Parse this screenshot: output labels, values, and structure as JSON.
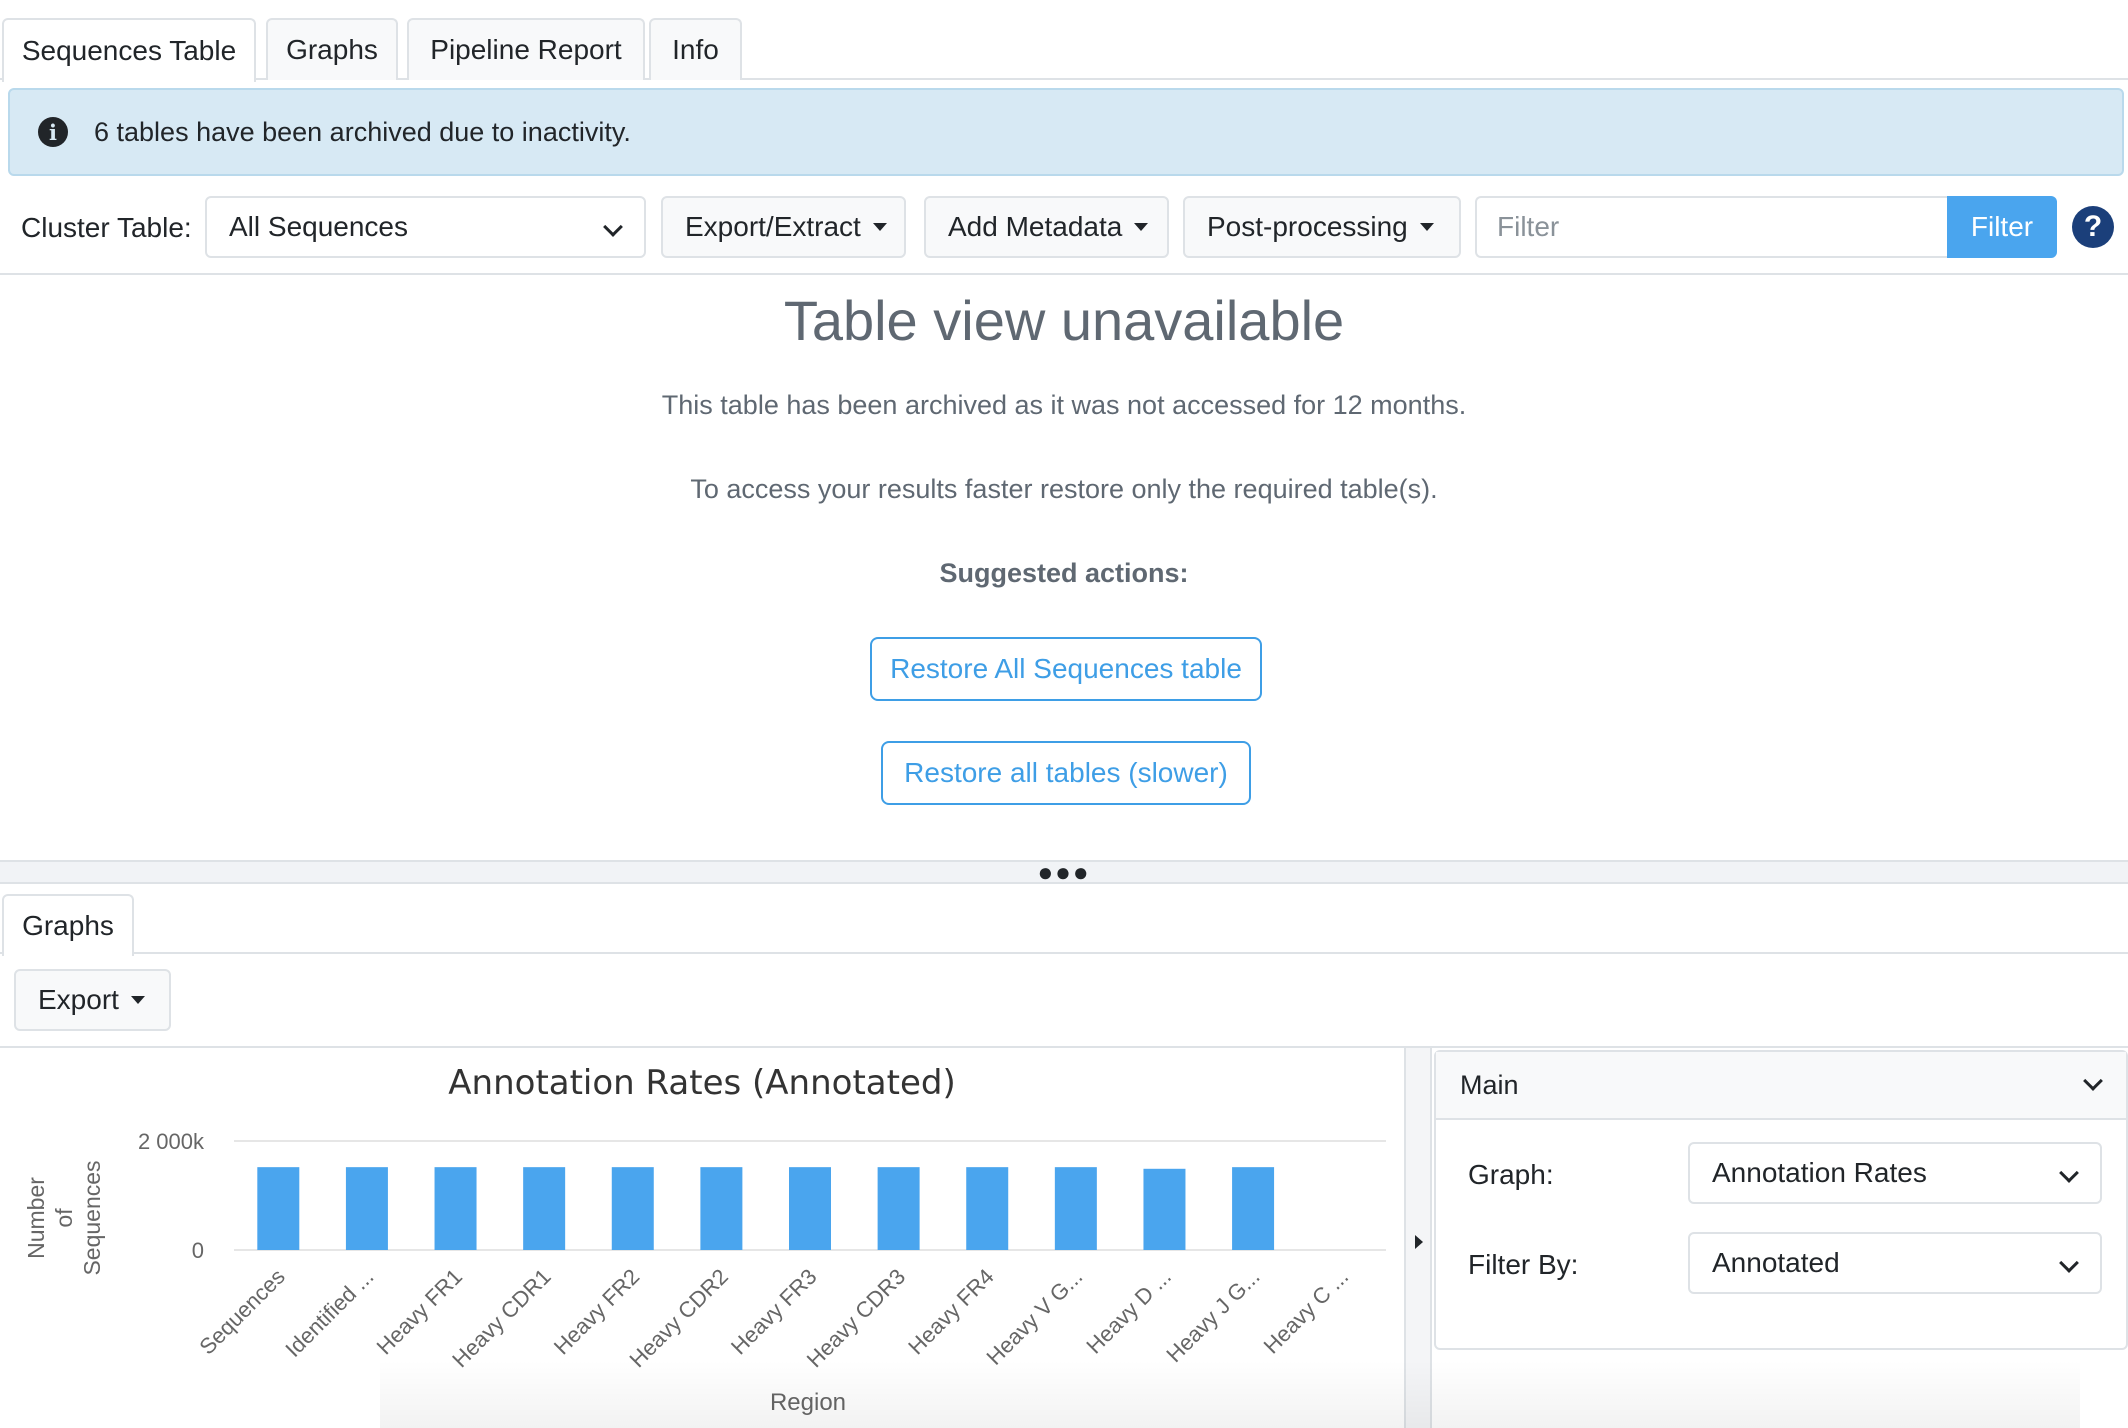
{
  "tabs": [
    "Sequences Table",
    "Graphs",
    "Pipeline Report",
    "Info"
  ],
  "alert": {
    "text": "6 tables have been archived due to inactivity.",
    "icon": "info-icon"
  },
  "toolbar": {
    "cluster_label": "Cluster Table:",
    "cluster_value": "All Sequences",
    "export_extract": "Export/Extract",
    "add_metadata": "Add Metadata",
    "post_processing": "Post-processing",
    "filter_placeholder": "Filter",
    "filter_button": "Filter",
    "help": "?"
  },
  "unavailable": {
    "title": "Table view unavailable",
    "message1": "This table has been archived as it was not accessed for 12 months.",
    "message2": "To access your results faster restore only the required table(s).",
    "suggested": "Suggested actions:",
    "restore_one": "Restore All Sequences table",
    "restore_all": "Restore all tables (slower)"
  },
  "graphs": {
    "tab": "Graphs",
    "export": "Export"
  },
  "colors": {
    "accent": "#4aa5ee",
    "bar": "#4aa5ee",
    "alert_bg": "#d7e9f4",
    "help": "#1b3f7a"
  },
  "chart_data": {
    "type": "bar",
    "title": "Annotation Rates (Annotated)",
    "xlabel": "Region",
    "ylabel": "Number of Sequences",
    "yticks": [
      "2 000k",
      "0"
    ],
    "ylim": [
      0,
      2000000
    ],
    "categories": [
      "Sequences",
      "Identified ...",
      "Heavy FR1",
      "Heavy CDR1",
      "Heavy FR2",
      "Heavy CDR2",
      "Heavy FR3",
      "Heavy CDR3",
      "Heavy FR4",
      "Heavy V G...",
      "Heavy D ...",
      "Heavy J G...",
      "Heavy C ..."
    ],
    "values": [
      1520000,
      1520000,
      1520000,
      1520000,
      1520000,
      1520000,
      1520000,
      1520000,
      1520000,
      1520000,
      1490000,
      1520000,
      0
    ],
    "grid": true
  },
  "settings": {
    "section": "Main",
    "graph_label": "Graph:",
    "graph_value": "Annotation Rates",
    "filter_label": "Filter By:",
    "filter_value": "Annotated"
  }
}
